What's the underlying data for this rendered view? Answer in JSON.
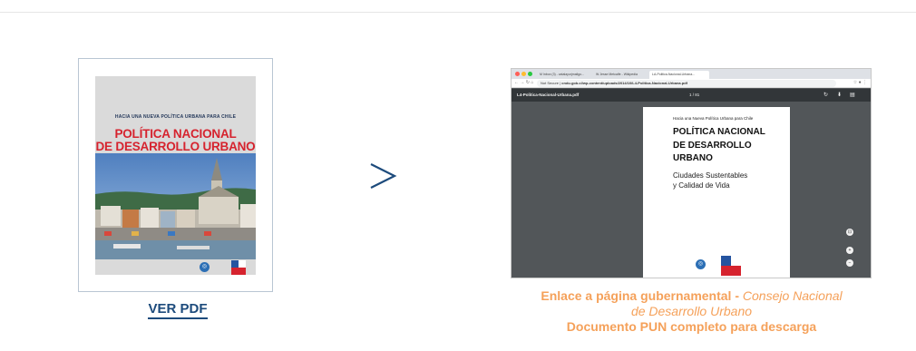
{
  "cover": {
    "subtitle": "HACIA UNA NUEVA POLÍTICA URBANA PARA CHILE",
    "title_line1": "POLÍTICA NACIONAL",
    "title_line2": "DE DESARROLLO URBANO"
  },
  "ver_pdf_label": "VER PDF",
  "arrow_glyph": ">",
  "browser": {
    "tabs": [
      "M Inbox (3) - catalayurjmailgo...",
      "W Jesse Metcalfe - Wikipedia",
      "LA-Politica-Nacional-Urbana..."
    ],
    "url_prefix": "Not Secure",
    "url": "cndu.gob.cl/wp-content/uploads/2014/10/L4-Politica-Nacional-Urbana.pdf",
    "pdf_filename": "L4-Politica-Nacional-Urbana.pdf",
    "page_indicator": "1 / 81",
    "pdf_page": {
      "subtitle": "Hacia una Nueva Política Urbana para Chile",
      "title_line1": "POLÍTICA NACIONAL",
      "title_line2": "DE DESARROLLO",
      "title_line3": "URBANO",
      "cs_line1": "Ciudades Sustentables",
      "cs_line2": "y Calidad de Vida"
    }
  },
  "caption": {
    "bold_part": "Enlace a página gubernamental -",
    "italic_part1": "Consejo Nacional",
    "italic_part2": "de Desarrollo Urbano",
    "line3": "Documento PUN completo para descarga"
  },
  "colors": {
    "accent_orange": "#f5a15a",
    "link_blue": "#1d4b7c",
    "cover_red": "#d6232e"
  }
}
